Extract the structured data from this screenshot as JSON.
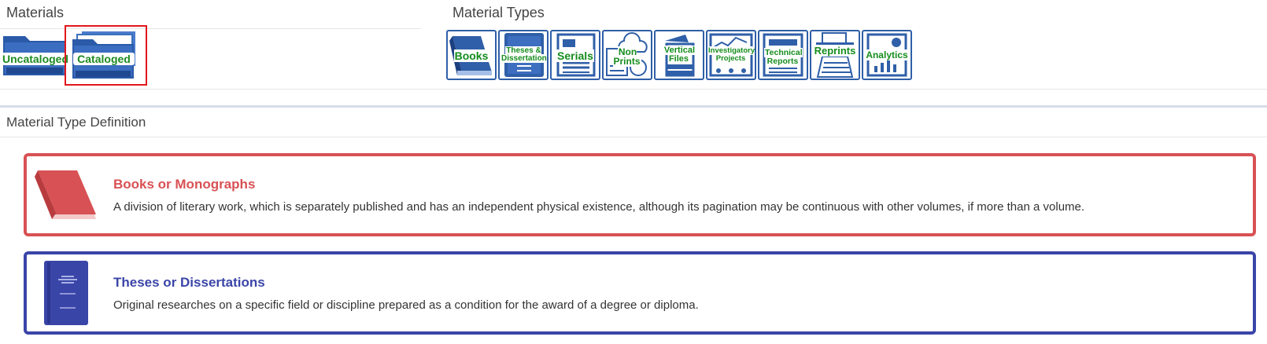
{
  "materials": {
    "heading": "Materials",
    "uncataloged_label": "Uncataloged",
    "cataloged_label": "Cataloged"
  },
  "material_types": {
    "heading": "Material Types",
    "tiles": [
      {
        "id": "books",
        "label": "Books"
      },
      {
        "id": "theses",
        "label": "Theses & Dissertations"
      },
      {
        "id": "serials",
        "label": "Serials"
      },
      {
        "id": "nonprints",
        "label": "Non Prints"
      },
      {
        "id": "vertical",
        "label": "Vertical Files"
      },
      {
        "id": "investigatory",
        "label": "Investigatory Projects"
      },
      {
        "id": "technical",
        "label": "Technical Reports"
      },
      {
        "id": "reprints",
        "label": "Reprints"
      },
      {
        "id": "analytics",
        "label": "Analytics"
      }
    ]
  },
  "definition": {
    "heading": "Material Type Definition",
    "items": [
      {
        "title": "Books or Monographs",
        "text": "A division of literary work, which is separately published and has an independent physical existence, although its pagination may be continuous with other volumes, if more than a volume.",
        "color": "#d85154"
      },
      {
        "title": "Theses or Dissertations",
        "text": "Original researches on a specific field or discipline prepared as a condition for the award of a degree or diploma.",
        "color": "#3a45a8"
      }
    ]
  },
  "colors": {
    "tile_border": "#2f5fa8",
    "label_green": "#148c1c",
    "selected_outline": "#e2161b"
  }
}
